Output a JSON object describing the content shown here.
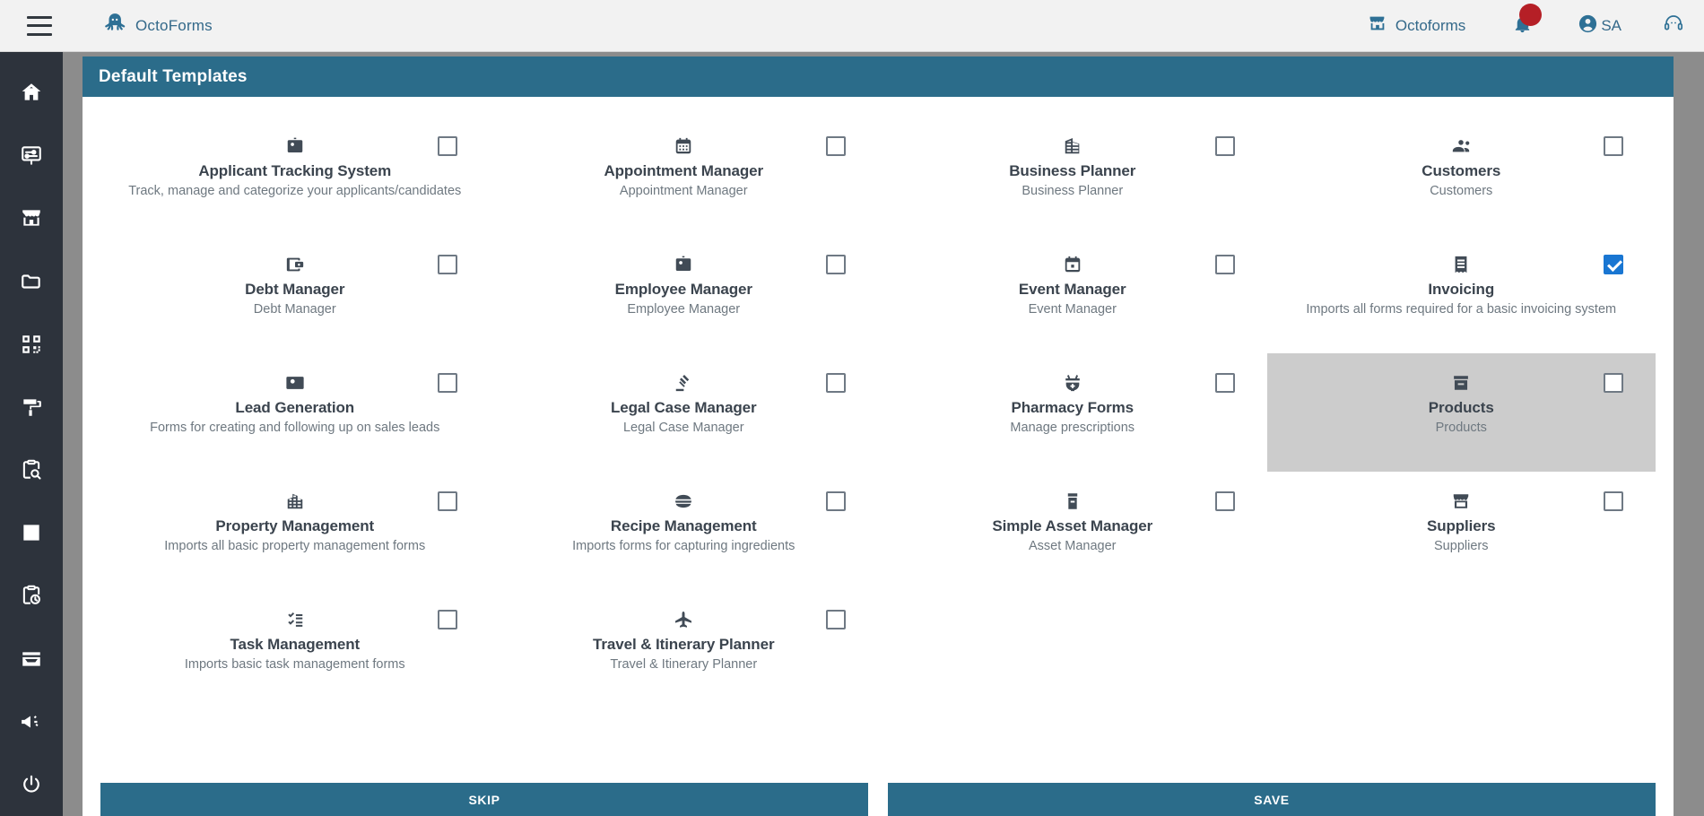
{
  "topbar": {
    "menu_icon": "hamburger-icon",
    "brand_logo": "octopus-logo",
    "brand_name": "OctoForms",
    "store_icon": "store-icon",
    "store_label": "Octoforms",
    "bell_icon": "bell-icon",
    "bell_badge": "",
    "user_icon": "account-circle-icon",
    "user_label": "SA",
    "support_icon": "headset-icon"
  },
  "sidebar": {
    "items": [
      {
        "name": "home",
        "icon": "home-icon"
      },
      {
        "name": "forms",
        "icon": "form-board-icon"
      },
      {
        "name": "store",
        "icon": "store-icon"
      },
      {
        "name": "folders",
        "icon": "folder-icon"
      },
      {
        "name": "qr-codes",
        "icon": "qr-code-icon"
      },
      {
        "name": "themes",
        "icon": "paint-roller-icon"
      },
      {
        "name": "inspections",
        "icon": "clipboard-search-icon"
      },
      {
        "name": "reports",
        "icon": "chart-box-icon"
      },
      {
        "name": "history",
        "icon": "clipboard-clock-icon"
      },
      {
        "name": "inbox",
        "icon": "inbox-icon"
      },
      {
        "name": "announcements",
        "icon": "megaphone-icon"
      },
      {
        "name": "logout",
        "icon": "power-icon"
      }
    ]
  },
  "panel": {
    "title": "Default Templates"
  },
  "templates": [
    {
      "title": "Applicant Tracking System",
      "subtitle": "Track, manage and categorize your applicants/candidates",
      "icon": "id-badge-icon",
      "checked": false,
      "hover": false
    },
    {
      "title": "Appointment Manager",
      "subtitle": "Appointment Manager",
      "icon": "calendar-month-icon",
      "checked": false,
      "hover": false
    },
    {
      "title": "Business Planner",
      "subtitle": "Business Planner",
      "icon": "office-building-icon",
      "checked": false,
      "hover": false
    },
    {
      "title": "Customers",
      "subtitle": "Customers",
      "icon": "people-icon",
      "checked": false,
      "hover": false
    },
    {
      "title": "Debt Manager",
      "subtitle": "Debt Manager",
      "icon": "wallet-icon",
      "checked": false,
      "hover": false
    },
    {
      "title": "Employee Manager",
      "subtitle": "Employee Manager",
      "icon": "id-badge-icon",
      "checked": false,
      "hover": false
    },
    {
      "title": "Event Manager",
      "subtitle": "Event Manager",
      "icon": "calendar-event-icon",
      "checked": false,
      "hover": false
    },
    {
      "title": "Invoicing",
      "subtitle": "Imports all forms required for a basic invoicing system",
      "icon": "invoice-icon",
      "checked": true,
      "hover": false
    },
    {
      "title": "Lead Generation",
      "subtitle": "Forms for creating and following up on sales leads",
      "icon": "contact-card-icon",
      "checked": false,
      "hover": false
    },
    {
      "title": "Legal Case Manager",
      "subtitle": "Legal Case Manager",
      "icon": "gavel-icon",
      "checked": false,
      "hover": false
    },
    {
      "title": "Pharmacy Forms",
      "subtitle": "Manage prescriptions",
      "icon": "mortar-pestle-icon",
      "checked": false,
      "hover": false
    },
    {
      "title": "Products",
      "subtitle": "Products",
      "icon": "package-icon",
      "checked": false,
      "hover": true
    },
    {
      "title": "Property Management",
      "subtitle": "Imports all basic property management forms",
      "icon": "buildings-icon",
      "checked": false,
      "hover": false
    },
    {
      "title": "Recipe Management",
      "subtitle": "Imports forms for capturing ingredients",
      "icon": "hamburger-food-icon",
      "checked": false,
      "hover": false
    },
    {
      "title": "Simple Asset Manager",
      "subtitle": "Asset Manager",
      "icon": "archive-icon",
      "checked": false,
      "hover": false
    },
    {
      "title": "Suppliers",
      "subtitle": "Suppliers",
      "icon": "storefront-icon",
      "checked": false,
      "hover": false
    },
    {
      "title": "Task Management",
      "subtitle": "Imports basic task management forms",
      "icon": "checklist-icon",
      "checked": false,
      "hover": false
    },
    {
      "title": "Travel & Itinerary Planner",
      "subtitle": "Travel & Itinerary Planner",
      "icon": "airplane-icon",
      "checked": false,
      "hover": false
    }
  ],
  "footer": {
    "skip_label": "SKIP",
    "save_label": "SAVE"
  },
  "colors": {
    "panel_header": "#2b6c8a",
    "button": "#2b6c8a",
    "rail": "#2d333c",
    "checkbox_checked": "#1976d2",
    "badge": "#b51f26",
    "brand_text": "#34698a",
    "hover_tile": "#cccccc"
  }
}
